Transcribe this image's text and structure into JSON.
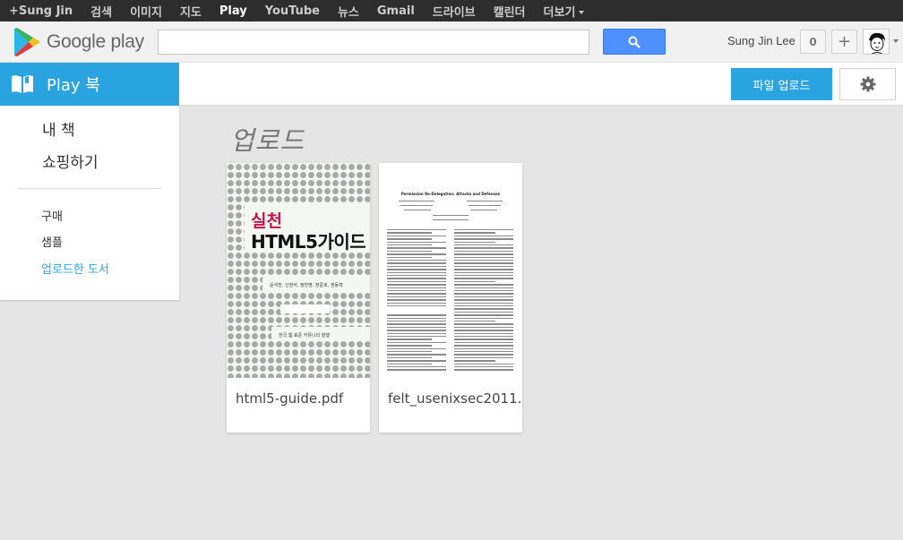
{
  "topbar": {
    "items": [
      {
        "label": "+Sung Jin"
      },
      {
        "label": "검색"
      },
      {
        "label": "이미지"
      },
      {
        "label": "지도"
      },
      {
        "label": "Play"
      },
      {
        "label": "YouTube"
      },
      {
        "label": "뉴스"
      },
      {
        "label": "Gmail"
      },
      {
        "label": "드라이브"
      },
      {
        "label": "캘린더"
      },
      {
        "label": "더보기"
      }
    ]
  },
  "header": {
    "logo_text": "Google play",
    "search": {
      "value": "",
      "placeholder": ""
    },
    "user_name": "Sung Jin Lee",
    "notification_count": "0",
    "share_label": "+"
  },
  "subheader": {
    "section_label": "Play 북",
    "upload_button": "파일 업로드"
  },
  "sidebar": {
    "primary": [
      {
        "label": "내 책"
      },
      {
        "label": "쇼핑하기"
      }
    ],
    "secondary": [
      {
        "label": "구매"
      },
      {
        "label": "샘플"
      },
      {
        "label": "업로드한 도서"
      }
    ]
  },
  "main": {
    "title": "업로드",
    "books": [
      {
        "filename": "html5-guide.pdf",
        "cover_title_red": "실천",
        "cover_title": "HTML5가이드",
        "cover_authors": "윤석찬, 신현석, 정찬명, 장준호, 권동혁",
        "cover_publisher": "한국 웹 표준 커뮤니티 발행"
      },
      {
        "filename": "felt_usenixsec2011.",
        "cover_title": "Permission Re-Delegation: Attacks and Defenses"
      }
    ]
  },
  "colors": {
    "accent": "#29a4e0",
    "topbar_bg": "#2d2d2d",
    "search_button": "#4d90fe"
  }
}
